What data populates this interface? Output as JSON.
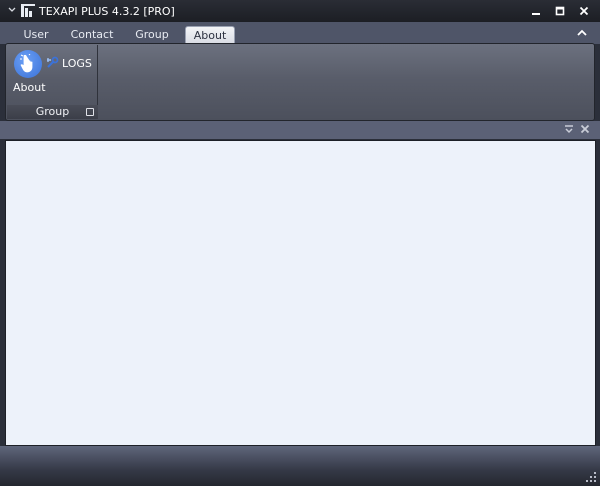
{
  "window": {
    "title": "TEXAPI PLUS 4.3.2 [PRO]"
  },
  "tabs": [
    {
      "label": "User"
    },
    {
      "label": "Contact"
    },
    {
      "label": "Group"
    },
    {
      "label": "About",
      "active": true
    }
  ],
  "ribbon": {
    "group_caption": "Group",
    "about_label": "About",
    "logs_label": "LOGS"
  },
  "colors": {
    "accent": "#3b72d8",
    "content_bg": "#edf2fa",
    "tab_bg": "#4f5568"
  },
  "icons": {
    "system_menu": "chevron-down-icon",
    "app_logo": "app-logo-icon",
    "minimize": "minimize-icon",
    "maximize": "maximize-icon",
    "close": "close-icon",
    "ribbon_collapse": "chevron-up-icon",
    "about": "hand-pointer-icon",
    "logs": "logs-icon",
    "dialog_launcher": "dialog-launcher-icon",
    "panel_pin": "pin-icon",
    "panel_close": "close-icon",
    "resize_grip": "resize-grip-icon"
  }
}
